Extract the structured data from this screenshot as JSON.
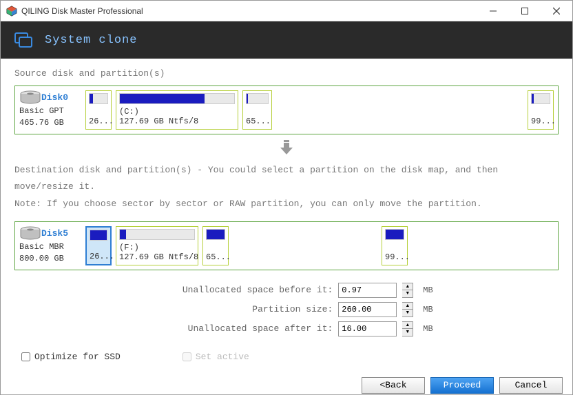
{
  "window": {
    "title": "QILING Disk Master Professional"
  },
  "header": {
    "heading": "System clone"
  },
  "source": {
    "label": "Source disk and partition(s)",
    "disk": {
      "name": "Disk0",
      "type": "Basic GPT",
      "size": "465.76 GB"
    },
    "partitions": [
      {
        "label": "26...",
        "fill_pct": 18
      },
      {
        "label_top": "(C:)",
        "label_bottom": "127.69 GB Ntfs/8",
        "fill_pct": 74
      },
      {
        "label": "65...",
        "fill_pct": 8
      },
      {
        "label": "99...",
        "fill_pct": 12
      }
    ]
  },
  "arrow": "↓",
  "dest": {
    "label1": "Destination disk and partition(s) - You could select a partition on the disk map, and then move/resize it.",
    "label2": "Note: If you choose sector by sector or RAW partition, you can only move the partition.",
    "disk": {
      "name": "Disk5",
      "type": "Basic MBR",
      "size": "800.00 GB"
    },
    "partitions": [
      {
        "label": "26...",
        "fill_pct": 100,
        "selected": true
      },
      {
        "label_top": "(F:)",
        "label_bottom": "127.69 GB Ntfs/8",
        "fill_pct": 8
      },
      {
        "label": "65...",
        "fill_pct": 100
      },
      {
        "label": "99...",
        "fill_pct": 100
      }
    ]
  },
  "form": {
    "before_label": "Unallocated space before it:",
    "before_value": "0.97",
    "size_label": "Partition size:",
    "size_value": "260.00",
    "after_label": "Unallocated space after it:",
    "after_value": "16.00",
    "unit": "MB"
  },
  "checks": {
    "optimize_label": "Optimize for SSD",
    "set_active_label": "Set active"
  },
  "buttons": {
    "back": "<Back",
    "proceed": "Proceed",
    "cancel": "Cancel"
  }
}
